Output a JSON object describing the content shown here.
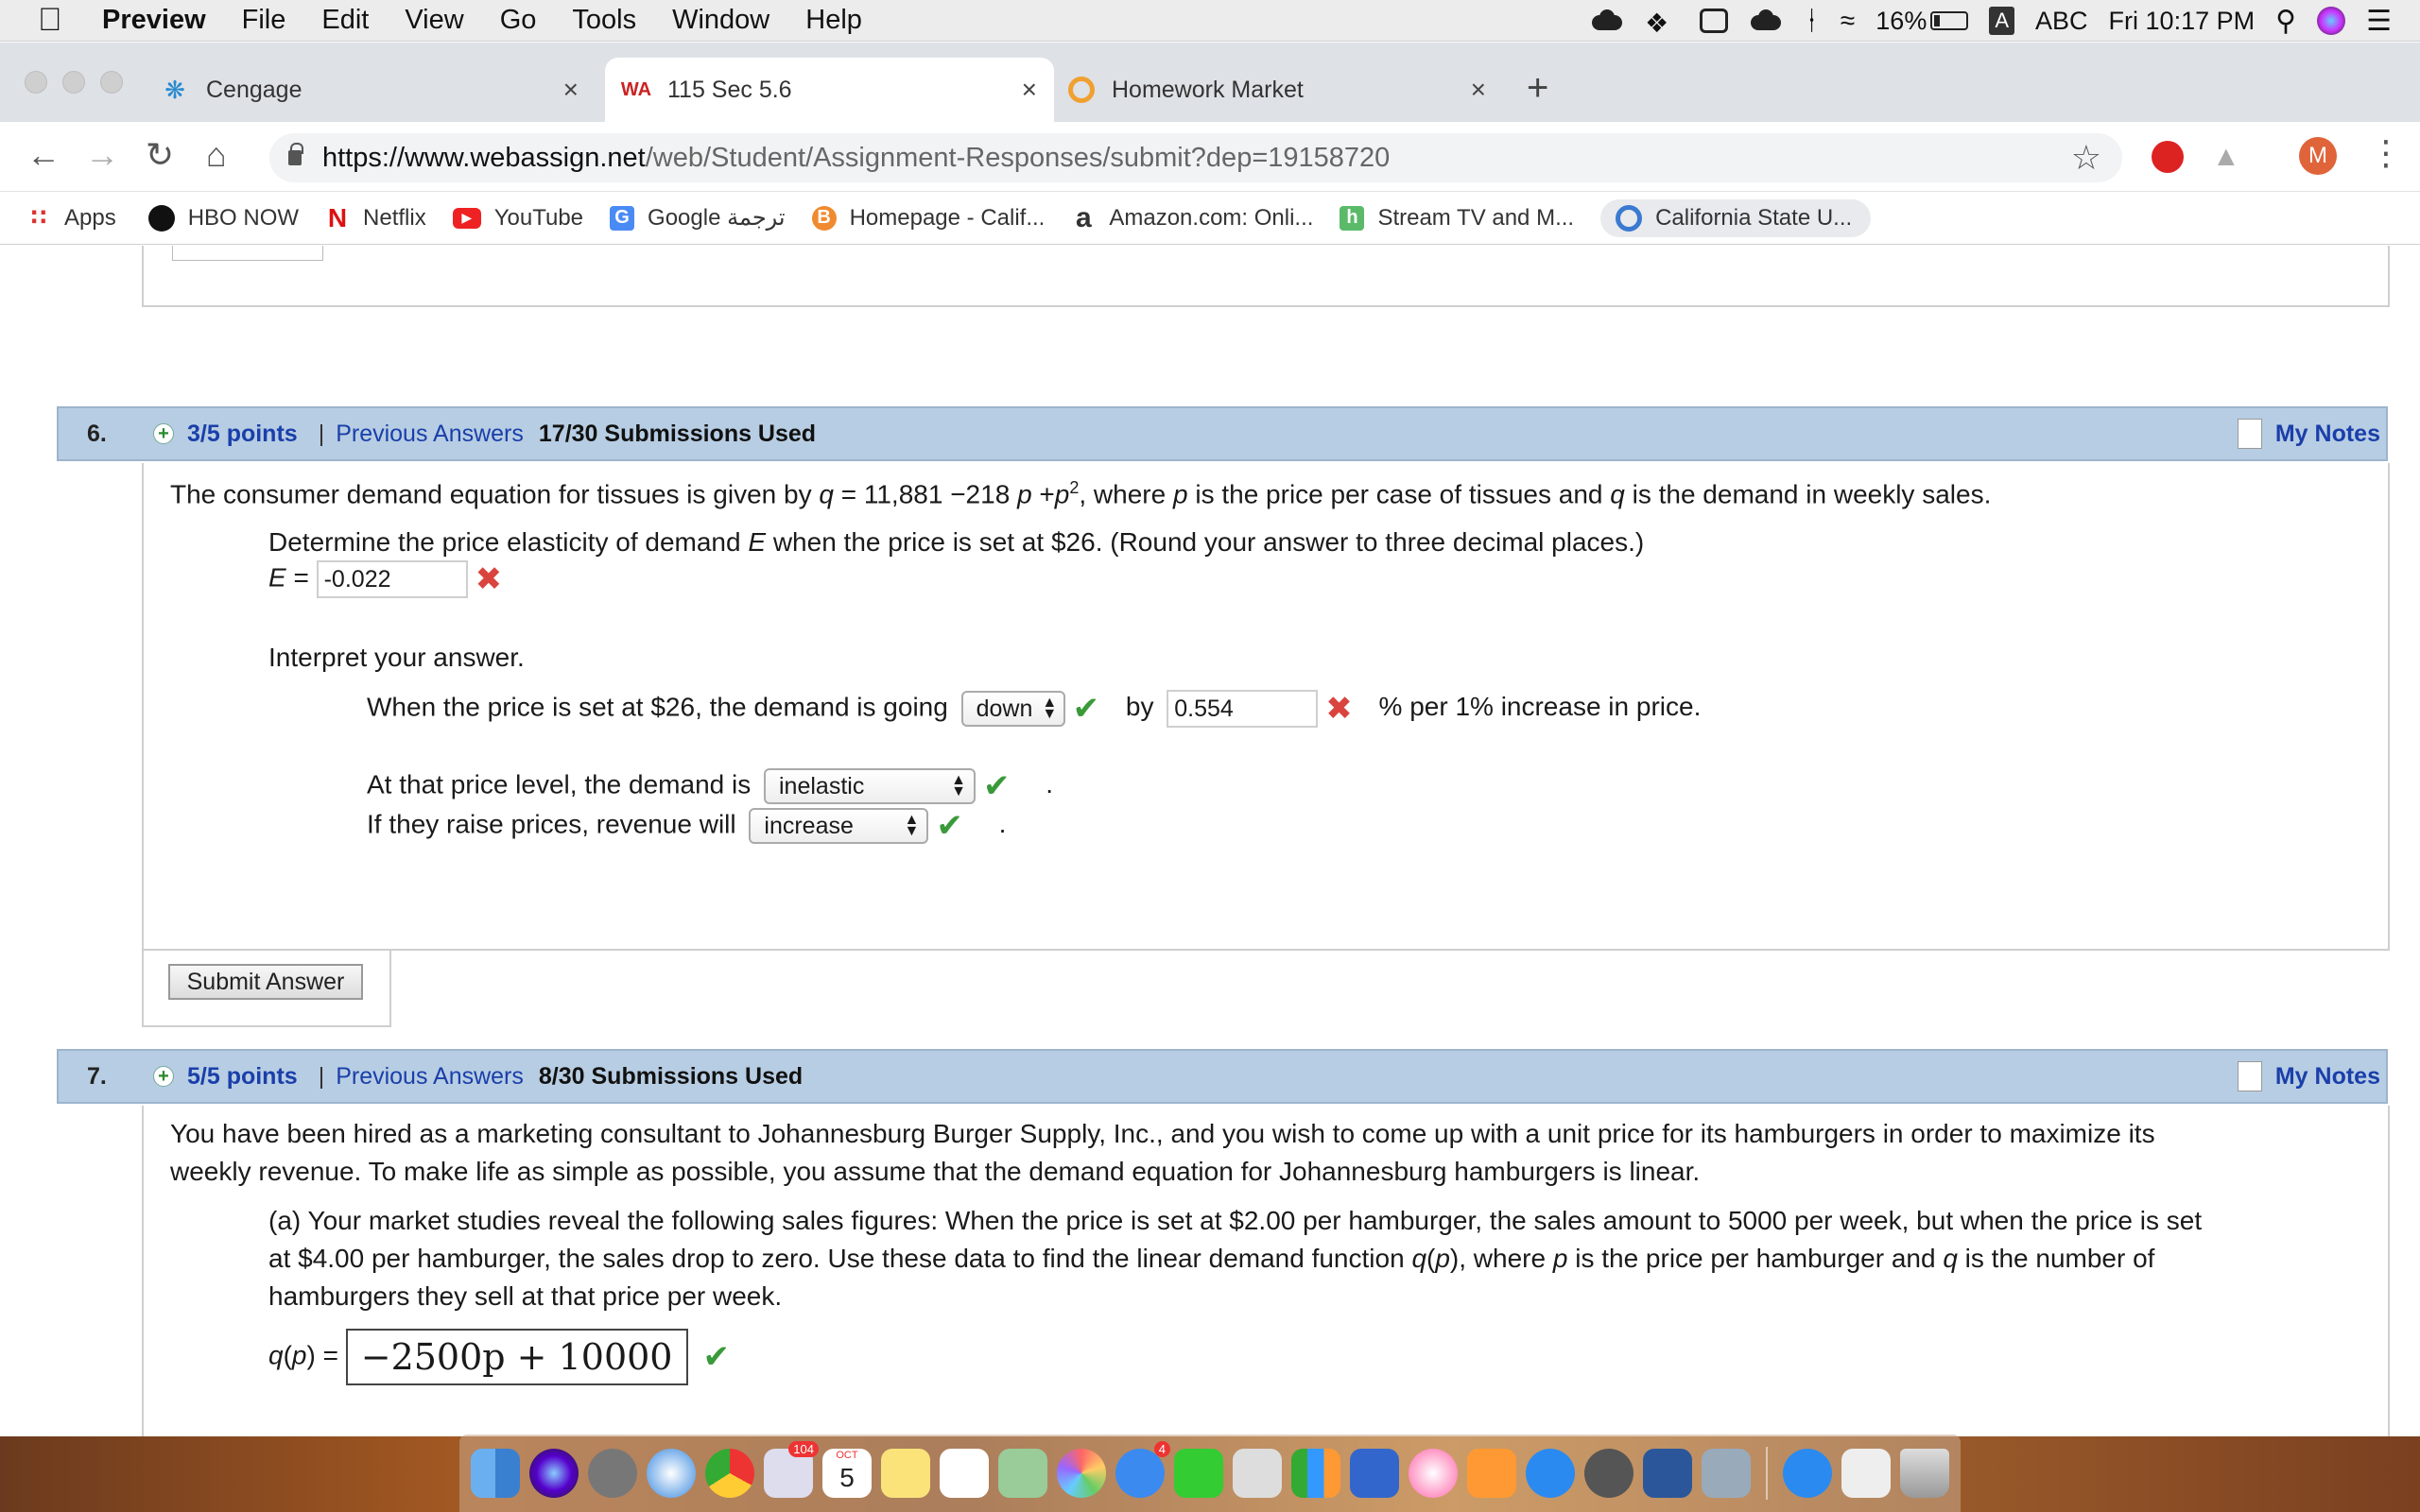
{
  "menubar": {
    "app": "Preview",
    "items": [
      "File",
      "Edit",
      "View",
      "Go",
      "Tools",
      "Window",
      "Help"
    ],
    "battery": "16%",
    "input_badge": "A",
    "input_label": "ABC",
    "clock": "Fri 10:17 PM"
  },
  "tabs": [
    {
      "label": "Cengage"
    },
    {
      "label": "115 Sec 5.6",
      "favicon": "WA"
    },
    {
      "label": "Homework Market"
    }
  ],
  "address": {
    "host": "https://www.webassign.net",
    "path": "/web/Student/Assignment-Responses/submit?dep=19158720",
    "avatar": "M"
  },
  "bookmarks": [
    {
      "label": "Apps",
      "icon": "apps-grid-icon"
    },
    {
      "label": "HBO NOW",
      "icon": "hbo-icon"
    },
    {
      "label": "Netflix",
      "icon": "netflix-icon",
      "glyph": "N"
    },
    {
      "label": "YouTube",
      "icon": "youtube-icon"
    },
    {
      "label": "Google ترجمة",
      "icon": "google-translate-icon",
      "glyph": "G"
    },
    {
      "label": "Homepage - Calif...",
      "icon": "homepage-icon",
      "glyph": "B"
    },
    {
      "label": "Amazon.com: Onli...",
      "icon": "amazon-icon",
      "glyph": "a"
    },
    {
      "label": "Stream TV and M...",
      "icon": "hulu-icon",
      "glyph": "h"
    },
    {
      "label": "California State U...",
      "icon": "csu-icon"
    }
  ],
  "questions": {
    "q6": {
      "number": "6.",
      "points": "3/5 points",
      "sep": "|",
      "previous": "Previous Answers",
      "submissions": "17/30 Submissions Used",
      "notes": "My Notes",
      "intro_a": "The consumer demand equation for tissues is given by ",
      "intro_q": "q",
      "intro_eq": " = 11,881 −218 ",
      "intro_p": "p",
      "intro_plus": " +",
      "intro_p2": "p",
      "intro_sup": "2",
      "intro_b": ",  where ",
      "intro_p3": "p",
      "intro_c": " is the price per case of tissues and ",
      "intro_q2": "q",
      "intro_d": " is the demand in weekly sales.",
      "part1_a": "Determine the price elasticity of demand ",
      "part1_E": "E",
      "part1_b": " when the price is set at $26. (Round your answer to three decimal places.)",
      "e_label": "E",
      "e_eq": " = ",
      "e_value": "-0.022",
      "interpret": "Interpret your answer.",
      "line1_a": "When the price is set at $26, the demand is going",
      "dir_value": "down",
      "by": "by",
      "pct_value": "0.554",
      "line1_b": "% per 1% increase in price.",
      "line2_a": "At that price level, the demand is",
      "elastic_value": "inelastic",
      "period1": ".",
      "line3_a": "If they raise prices, revenue will",
      "revenue_value": "increase",
      "period2": ".",
      "submit": "Submit Answer"
    },
    "q7": {
      "number": "7.",
      "points": "5/5 points",
      "sep": "|",
      "previous": "Previous Answers",
      "submissions": "8/30 Submissions Used",
      "notes": "My Notes",
      "intro_1": "You have been hired as a marketing consultant to Johannesburg Burger Supply, Inc., and you wish to come up with a unit price for its hamburgers in order to maximize its",
      "intro_2": "weekly revenue. To make life as simple as possible, you assume that the demand equation for Johannesburg hamburgers is linear.",
      "a_1": "(a) Your market studies reveal the following sales figures: When the price is set at $2.00 per hamburger, the sales amount to 5000 per week, but when the price is set",
      "a_2a": "at $4.00 per hamburger, the sales drop to zero. Use these data to find the linear demand function ",
      "a_2q": "q",
      "a_2paren": "(",
      "a_2p": "p",
      "a_2close": ")",
      "a_2b": ", where ",
      "a_2p2": "p",
      "a_2c": " is the price per hamburger and ",
      "a_2q2": "q",
      "a_2d": " is the number of",
      "a_3": "hamburgers they sell at that price per week.",
      "qp_q": "q",
      "qp_open": "(",
      "qp_p": "p",
      "qp_close": ")",
      "qp_eq": " = ",
      "answer": "−2500p + 10000"
    }
  },
  "dock": {
    "calendar_month": "OCT",
    "calendar_day": "5",
    "mail_badge": "104",
    "messages_badge": "4"
  }
}
